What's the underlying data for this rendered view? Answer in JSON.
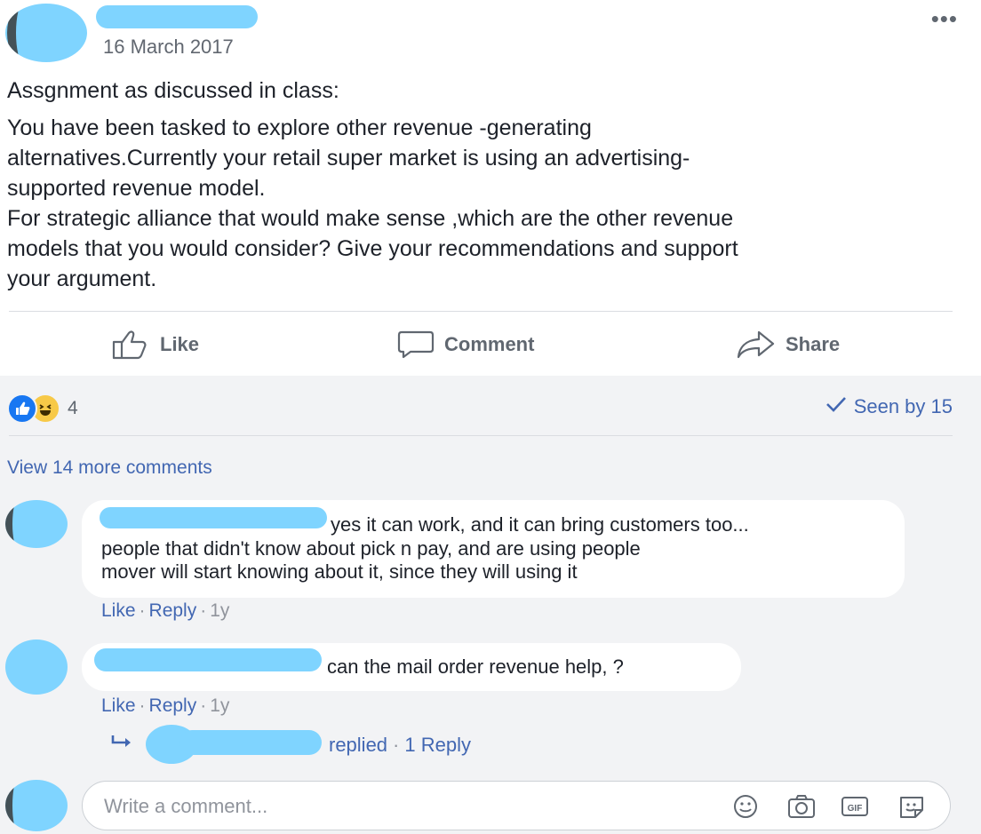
{
  "post": {
    "more_label": "•••",
    "date": "16 March 2017",
    "heading": "Assgnment as discussed in class:",
    "body_lines": [
      "You have been tasked to explore other revenue -generating",
      "alternatives.Currently your retail super market is using an advertising-",
      "supported revenue model.",
      "For strategic alliance that would make sense ,which are the other revenue",
      "models that you would consider? Give your recommendations and support",
      "your argument."
    ]
  },
  "actions": {
    "like": "Like",
    "comment": "Comment",
    "share": "Share"
  },
  "stats": {
    "reaction_count": "4",
    "seen_by": "Seen by 15"
  },
  "comments_section": {
    "view_more": "View 14 more comments",
    "comments": [
      {
        "lines": [
          "yes it can work, and it can bring customers too...",
          "people that didn't know about pick n pay, and are using people",
          "mover will start knowing about it, since they will using it"
        ],
        "like": "Like",
        "reply": "Reply",
        "time": "1y"
      },
      {
        "lines": [
          "can the mail order revenue help, ?"
        ],
        "like": "Like",
        "reply": "Reply",
        "time": "1y"
      }
    ],
    "replies": {
      "replied_text": "replied",
      "reply_count": "1 Reply"
    }
  },
  "composer": {
    "placeholder": "Write a comment..."
  },
  "colors": {
    "link": "#4267b2",
    "secondary_text": "#606770",
    "redaction": "#7fd4ff",
    "feed_bg": "#f2f3f5"
  }
}
